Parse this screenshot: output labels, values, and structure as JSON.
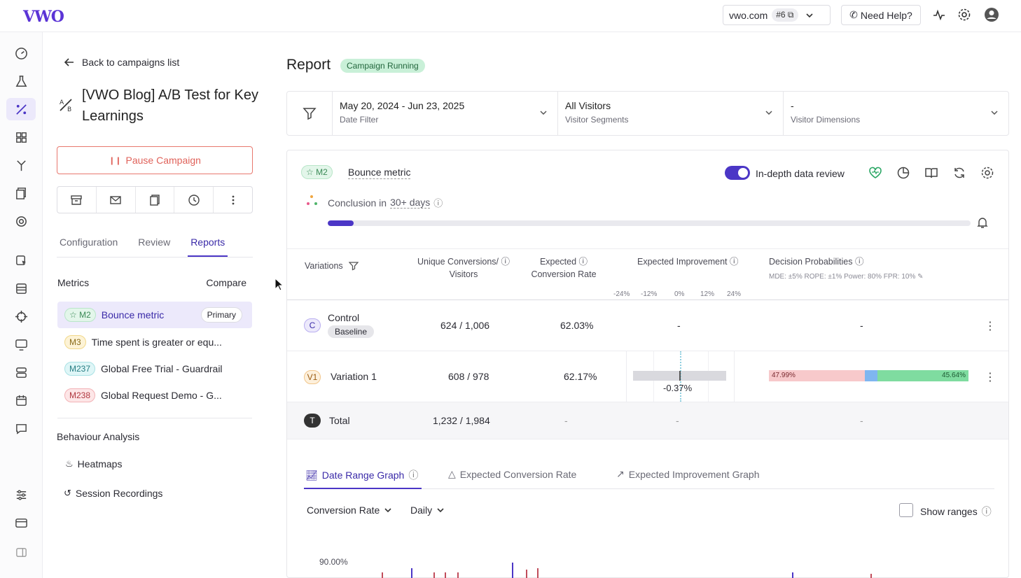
{
  "topbar": {
    "logo": "VWO",
    "domain": "vwo.com",
    "domain_badge": "#6",
    "need_help": "Need Help?"
  },
  "sidebar": {
    "back": "Back to campaigns list",
    "campaign_title": "[VWO Blog] A/B Test for Key Learnings",
    "pause": "Pause Campaign",
    "tabs": [
      "Configuration",
      "Review",
      "Reports"
    ],
    "metrics_label": "Metrics",
    "compare_label": "Compare",
    "metrics": [
      {
        "badge": "M2",
        "name": "Bounce metric",
        "tag": "Primary"
      },
      {
        "badge": "M3",
        "name": "Time spent is greater or equ..."
      },
      {
        "badge": "M237",
        "name": "Global Free Trial - Guardrail"
      },
      {
        "badge": "M238",
        "name": "Global Request Demo - G..."
      }
    ],
    "behaviour_title": "Behaviour Analysis",
    "heatmaps": "Heatmaps",
    "recordings": "Session Recordings"
  },
  "main": {
    "title": "Report",
    "status": "Campaign Running",
    "filters": [
      {
        "value": "May 20, 2024 - Jun 23, 2025",
        "label": "Date Filter"
      },
      {
        "value": "All Visitors",
        "label": "Visitor Segments"
      },
      {
        "value": "-",
        "label": "Visitor Dimensions"
      }
    ],
    "card": {
      "metric_badge": "M2",
      "metric_name": "Bounce metric",
      "toggle_label": "In-depth data review",
      "conclusion_prefix": "Conclusion in",
      "conclusion_days": "30+ days",
      "progress_fraction": 0.04
    },
    "table": {
      "headers": {
        "variations": "Variations",
        "conv_line1": "Unique Conversions/",
        "conv_line2": "Visitors",
        "rate_line1": "Expected",
        "rate_line2": "Conversion Rate",
        "improvement": "Expected Improvement",
        "decision": "Decision Probabilities",
        "decision_sub": "MDE: ±5% ROPE: ±1% Power: 80% FPR: 10%"
      },
      "scale": [
        "-24%",
        "-12%",
        "0%",
        "12%",
        "24%"
      ],
      "rows": [
        {
          "badge": "C",
          "name": "Control",
          "tag": "Baseline",
          "conversions": "624 / 1,006",
          "rate": "62.03%",
          "improvement": "-",
          "decision": "-"
        },
        {
          "badge": "V1",
          "name": "Variation 1",
          "conversions": "608 / 978",
          "rate": "62.17%",
          "improvement": "-0.37%",
          "prob_left": "47.99%",
          "prob_right": "45.64%"
        },
        {
          "badge": "T",
          "name": "Total",
          "conversions": "1,232 / 1,984",
          "rate": "-",
          "improvement": "-",
          "decision": "-"
        }
      ]
    },
    "graph_tabs": [
      "Date Range Graph",
      "Expected Conversion Rate",
      "Expected Improvement Graph"
    ],
    "metric_dropdown": "Conversion Rate",
    "period_dropdown": "Daily",
    "show_ranges": "Show ranges",
    "y_tick": "90.00%"
  },
  "colors": {
    "accent": "#4b36c6",
    "danger": "#e0625a",
    "success_pill": "#c9f0d8"
  }
}
